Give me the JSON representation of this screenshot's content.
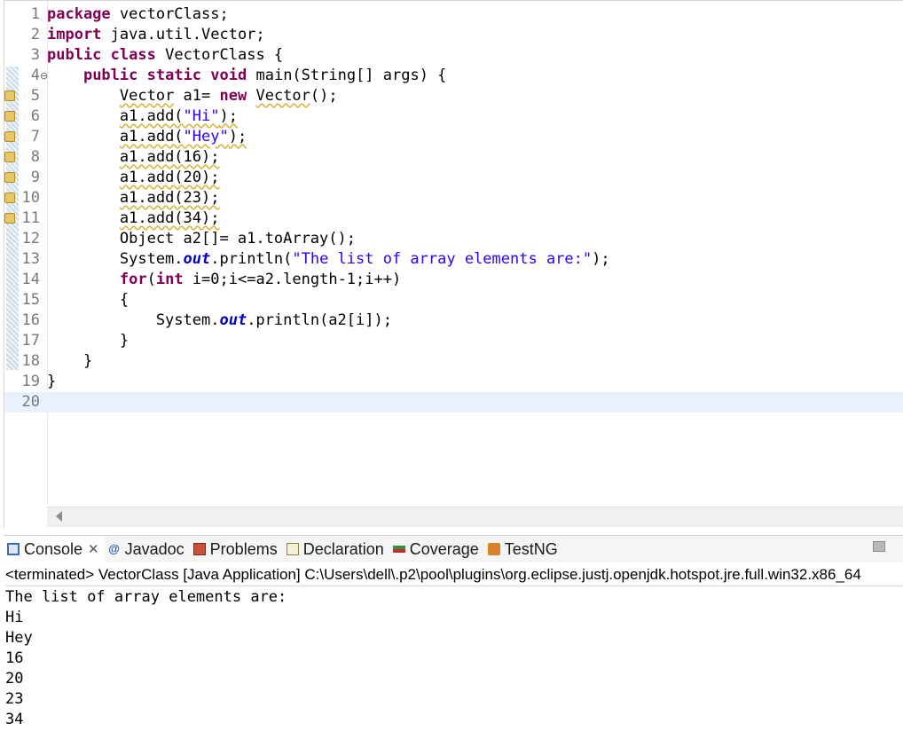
{
  "editor": {
    "lines": [
      {
        "n": "1",
        "segs": [
          {
            "t": "package",
            "c": "kw"
          },
          {
            "t": " vectorClass;"
          }
        ]
      },
      {
        "n": "2",
        "segs": [
          {
            "t": "import",
            "c": "kw"
          },
          {
            "t": " java.util.Vector;"
          }
        ]
      },
      {
        "n": "3",
        "segs": [
          {
            "t": "public",
            "c": "kw"
          },
          {
            "t": " "
          },
          {
            "t": "class",
            "c": "kw"
          },
          {
            "t": " VectorClass {"
          }
        ]
      },
      {
        "n": "4",
        "fold": true,
        "segs": [
          {
            "t": "    "
          },
          {
            "t": "public",
            "c": "kw"
          },
          {
            "t": " "
          },
          {
            "t": "static",
            "c": "kw"
          },
          {
            "t": " "
          },
          {
            "t": "void",
            "c": "kw"
          },
          {
            "t": " main(String[] args) {"
          }
        ]
      },
      {
        "n": "5",
        "marker": true,
        "segs": [
          {
            "t": "        "
          },
          {
            "t": "Vector",
            "c": "warn"
          },
          {
            "t": " a1= "
          },
          {
            "t": "new",
            "c": "kw"
          },
          {
            "t": " "
          },
          {
            "t": "Vector",
            "c": "warn"
          },
          {
            "t": "();"
          }
        ]
      },
      {
        "n": "6",
        "marker": true,
        "segs": [
          {
            "t": "        "
          },
          {
            "t": "a1.add(",
            "c": "warn"
          },
          {
            "t": "\"Hi\"",
            "c": "str warn"
          },
          {
            "t": ");",
            "c": "warn"
          }
        ]
      },
      {
        "n": "7",
        "marker": true,
        "segs": [
          {
            "t": "        "
          },
          {
            "t": "a1.add(",
            "c": "warn"
          },
          {
            "t": "\"Hey\"",
            "c": "str warn"
          },
          {
            "t": ");",
            "c": "warn"
          }
        ]
      },
      {
        "n": "8",
        "marker": true,
        "segs": [
          {
            "t": "        "
          },
          {
            "t": "a1.add(16);",
            "c": "warn"
          }
        ]
      },
      {
        "n": "9",
        "marker": true,
        "segs": [
          {
            "t": "        "
          },
          {
            "t": "a1.add(20);",
            "c": "warn"
          }
        ]
      },
      {
        "n": "10",
        "marker": true,
        "segs": [
          {
            "t": "        "
          },
          {
            "t": "a1.add(23);",
            "c": "warn"
          }
        ]
      },
      {
        "n": "11",
        "marker": true,
        "segs": [
          {
            "t": "        "
          },
          {
            "t": "a1.add(34);",
            "c": "warn"
          }
        ]
      },
      {
        "n": "12",
        "segs": [
          {
            "t": "        Object a2[]= a1.toArray();"
          }
        ]
      },
      {
        "n": "13",
        "segs": [
          {
            "t": "        System."
          },
          {
            "t": "out",
            "c": "field"
          },
          {
            "t": ".println("
          },
          {
            "t": "\"The list of array elements are:\"",
            "c": "str"
          },
          {
            "t": ");"
          }
        ]
      },
      {
        "n": "14",
        "segs": [
          {
            "t": "        "
          },
          {
            "t": "for",
            "c": "kw"
          },
          {
            "t": "("
          },
          {
            "t": "int",
            "c": "kw"
          },
          {
            "t": " i=0;i<=a2.length-1;i++)"
          }
        ]
      },
      {
        "n": "15",
        "segs": [
          {
            "t": "        {"
          }
        ]
      },
      {
        "n": "16",
        "segs": [
          {
            "t": "            System."
          },
          {
            "t": "out",
            "c": "field"
          },
          {
            "t": ".println(a2[i]);"
          }
        ]
      },
      {
        "n": "17",
        "segs": [
          {
            "t": "        }"
          }
        ]
      },
      {
        "n": "18",
        "segs": [
          {
            "t": "    }"
          }
        ]
      },
      {
        "n": "19",
        "segs": [
          {
            "t": "}"
          }
        ]
      },
      {
        "n": "20",
        "current": true,
        "segs": [
          {
            "t": ""
          }
        ]
      }
    ]
  },
  "panel": {
    "tabs": [
      {
        "label": "Console",
        "icon": "console-icon",
        "cls": "ico-console",
        "active": true,
        "closable": true
      },
      {
        "label": "Javadoc",
        "icon": "javadoc-icon",
        "cls": "ico-javadoc",
        "glyph": "@"
      },
      {
        "label": "Problems",
        "icon": "problems-icon",
        "cls": "ico-problems"
      },
      {
        "label": "Declaration",
        "icon": "declaration-icon",
        "cls": "ico-declaration"
      },
      {
        "label": "Coverage",
        "icon": "coverage-icon",
        "cls": "ico-coverage"
      },
      {
        "label": "TestNG",
        "icon": "testng-icon",
        "cls": "ico-testng"
      }
    ],
    "status": "<terminated> VectorClass [Java Application] C:\\Users\\dell\\.p2\\pool\\plugins\\org.eclipse.justj.openjdk.hotspot.jre.full.win32.x86_64",
    "output": [
      "The list of array elements are:",
      "Hi",
      "Hey",
      "16",
      "20",
      "23",
      "34"
    ]
  }
}
